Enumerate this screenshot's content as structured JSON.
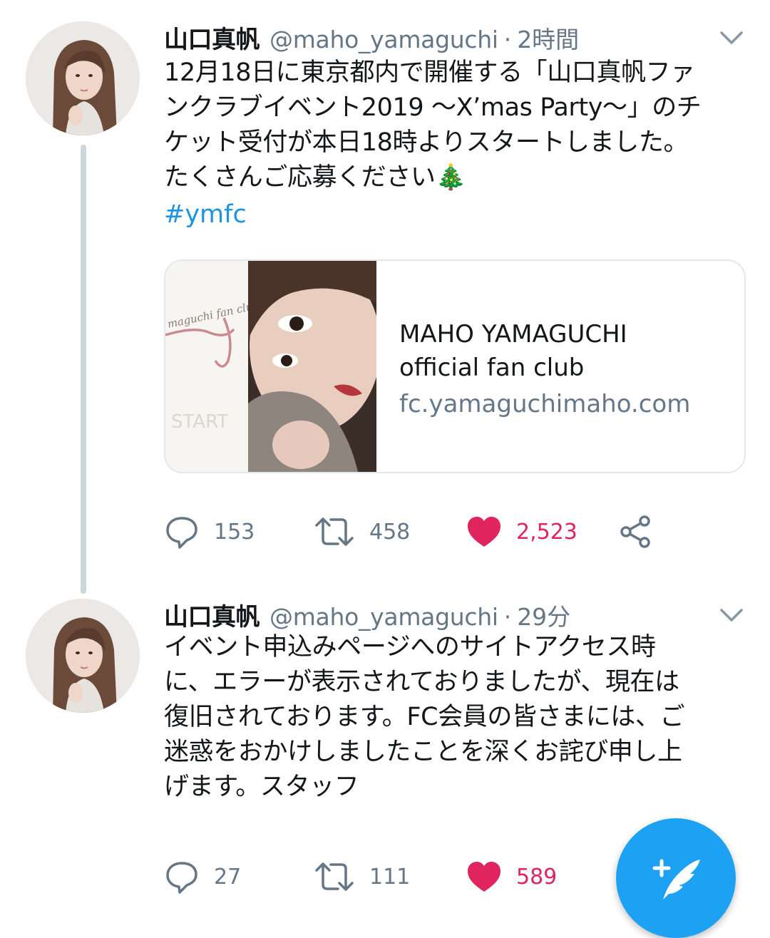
{
  "tweets": [
    {
      "display_name": "山口真帆",
      "handle": "@maho_yamaguchi",
      "separator": "·",
      "time": "2時間",
      "text": "12月18日に東京都内で開催する「山口真帆ファ\nンクラブイベント2019 〜X’mas Party〜」のチ\nケット受付が本日18時よりスタートしました。\nたくさんご応募ください🎄",
      "hashtag": "#ymfc",
      "card": {
        "title_line1": "MAHO YAMAGUCHI",
        "title_line2": "official fan club",
        "domain": "fc.yamaguchimaho.com",
        "image_logo_text": "maguchi fan club",
        "image_start_text": "START"
      },
      "counts": {
        "replies": "153",
        "retweets": "458",
        "likes": "2,523"
      },
      "liked": true
    },
    {
      "display_name": "山口真帆",
      "handle": "@maho_yamaguchi",
      "separator": "·",
      "time": "29分",
      "text": "イベント申込みページへのサイトアクセス時\nに、エラーが表示されておりましたが、現在は\n復旧されております。FC会員の皆さまには、ご\n迷惑をおかけしましたことを深くお詫び申し上\nげます。スタッフ",
      "counts": {
        "replies": "27",
        "retweets": "111",
        "likes": "589"
      },
      "liked": true
    }
  ],
  "icons": {
    "reply": "reply-icon",
    "retweet": "retweet-icon",
    "like": "heart-icon",
    "share": "share-icon",
    "caret": "chevron-down-icon",
    "compose": "compose-tweet-icon"
  },
  "colors": {
    "text": "#14171a",
    "secondary": "#657786",
    "link": "#1b95e0",
    "like": "#e0245e",
    "accent": "#1da1f2",
    "border": "#e1e8ed",
    "thread_line": "#ccd6dd"
  }
}
